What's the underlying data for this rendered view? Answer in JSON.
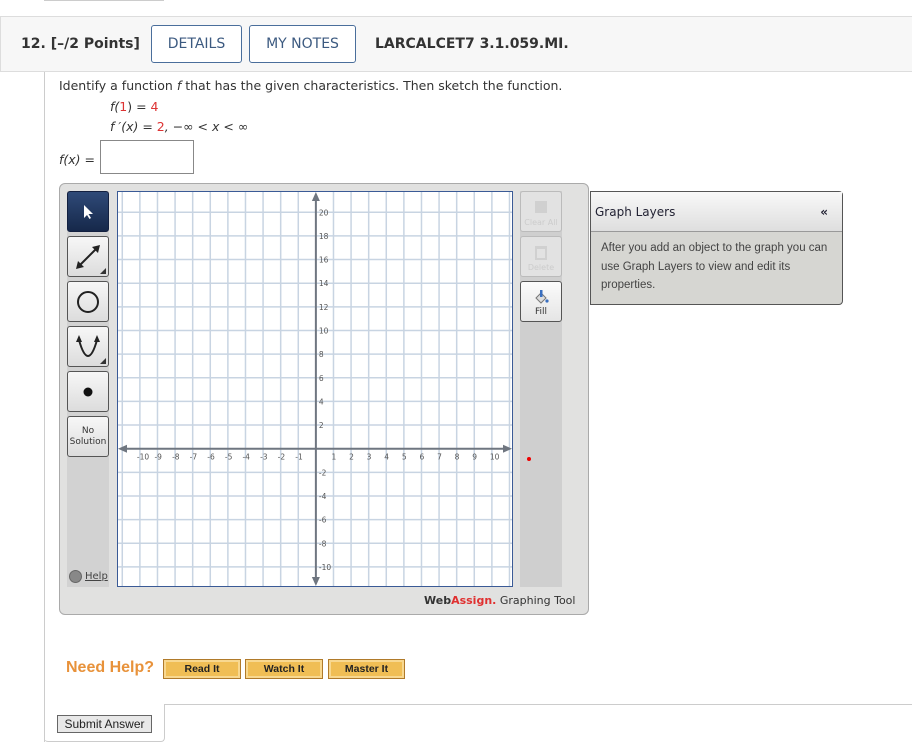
{
  "question": {
    "number": "12.",
    "points": "[–/2 Points]",
    "details_label": "DETAILS",
    "notes_label": "MY NOTES",
    "code": "LARCALCET7 3.1.059.MI."
  },
  "prompt": {
    "text_before": "Identify a function ",
    "f": "f",
    "text_after": " that has the given characteristics. Then sketch the function.",
    "eq1": {
      "lhs": "f(",
      "arg": "1",
      "mid": ") = ",
      "val": "4"
    },
    "eq2": {
      "lhs": "f ′(x) = ",
      "val": "2",
      "rest": ", −∞ < x < ∞"
    },
    "answer_label": "f(x) =",
    "answer_value": ""
  },
  "toolbar": {
    "tools": [
      {
        "name": "select",
        "icon": "pointer-arrow-icon",
        "active": true
      },
      {
        "name": "line",
        "icon": "double-arrow-line-icon"
      },
      {
        "name": "circle",
        "icon": "circle-icon"
      },
      {
        "name": "parabola",
        "icon": "parabola-icon"
      },
      {
        "name": "point",
        "icon": "point-icon"
      }
    ],
    "no_solution": [
      "No",
      "Solution"
    ],
    "help": "Help"
  },
  "actions": {
    "clear_all": "Clear All",
    "delete": "Delete",
    "fill": "Fill"
  },
  "graph": {
    "x_range": [
      -11.3,
      11.2
    ],
    "y_range": [
      -11.7,
      21.8
    ],
    "x_ticks": [
      "-10",
      "-9",
      "-8",
      "-7",
      "-6",
      "-5",
      "-4",
      "-3",
      "-2",
      "-1",
      "1",
      "2",
      "3",
      "4",
      "5",
      "6",
      "7",
      "8",
      "9",
      "10"
    ],
    "y_ticks": [
      "20",
      "18",
      "16",
      "14",
      "12",
      "10",
      "8",
      "6",
      "4",
      "2",
      "-2",
      "-4",
      "-6",
      "-8",
      "-10"
    ],
    "grid_color": "#c8d4e2",
    "axis_color": "#6f7680",
    "border_color": "#3a5a96"
  },
  "brand": {
    "web": "Web",
    "assign": "Assign.",
    "tool": " Graphing Tool",
    "accent": "#e03030"
  },
  "layers": {
    "title": "Graph Layers",
    "collapse": "«",
    "body": "After you add an object to the graph you can use Graph Layers to view and edit its properties."
  },
  "help": {
    "label": "Need Help?",
    "read": "Read It",
    "watch": "Watch It",
    "master": "Master It"
  },
  "submit": "Submit Answer"
}
